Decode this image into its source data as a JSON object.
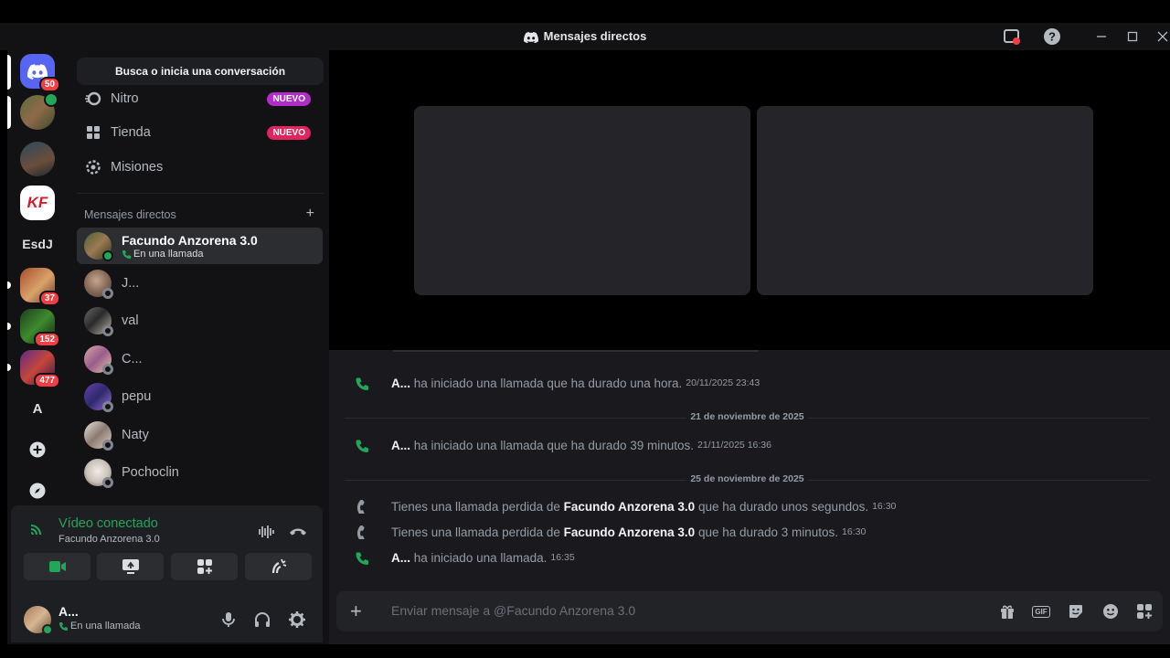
{
  "window": {
    "title": "Mensajes directos",
    "controls": [
      "minimize",
      "maximize",
      "close"
    ]
  },
  "guilds": {
    "home_badge": "50",
    "esdj_label": "EsdJ",
    "a_label": "A",
    "badges": {
      "g6": "37",
      "g7": "152",
      "g8": "477"
    }
  },
  "sidebar": {
    "search_label": "Busca o inicia una conversación",
    "nav": [
      {
        "label": "Nitro",
        "badge": "NUEVO"
      },
      {
        "label": "Tienda",
        "badge": "NUEVO"
      },
      {
        "label": "Misiones"
      }
    ],
    "dm_header": "Mensajes directos",
    "dm_add": "+",
    "dms": [
      {
        "name": "Facundo Anzorena 3.0",
        "sub": "En una llamada",
        "status": "online"
      },
      {
        "name": "J...",
        "status": "offline"
      },
      {
        "name": "val",
        "status": "offline"
      },
      {
        "name": "C...",
        "status": "offline"
      },
      {
        "name": "pepu",
        "status": "offline"
      },
      {
        "name": "Naty",
        "status": "offline"
      },
      {
        "name": "Pochoclin",
        "status": "offline"
      }
    ]
  },
  "voice": {
    "status": "Vídeo conectado",
    "channel": "Facundo Anzorena 3.0"
  },
  "user": {
    "name": "A...",
    "status": "En una llamada"
  },
  "messages": [
    {
      "author": "A...",
      "text": "ha iniciado una llamada que ha durado una hora.",
      "time": "20/11/2025 23:43",
      "type": "call"
    },
    {
      "separator": "21 de noviembre de 2025"
    },
    {
      "author": "A...",
      "text": "ha iniciado una llamada que ha durado 39 minutos.",
      "time": "21/11/2025 16:36",
      "type": "call"
    },
    {
      "separator": "25 de noviembre de 2025"
    },
    {
      "prefix": "Tienes una llamada perdida de",
      "author": "Facundo Anzorena 3.0",
      "text": "que ha durado unos segundos.",
      "time": "16:30",
      "type": "missed"
    },
    {
      "prefix": "Tienes una llamada perdida de",
      "author": "Facundo Anzorena 3.0",
      "text": "que ha durado 3 minutos.",
      "time": "16:30",
      "type": "missed"
    },
    {
      "author": "A...",
      "text": "ha iniciado una llamada.",
      "time": "16:35",
      "type": "call"
    }
  ],
  "composer": {
    "placeholder": "Enviar mensaje a @Facundo Anzorena 3.0",
    "gif_label": "GIF"
  },
  "colors": {
    "accent": "#5865f2",
    "online": "#23a55a",
    "danger": "#f23f43",
    "nuevo": "#e0245e"
  }
}
